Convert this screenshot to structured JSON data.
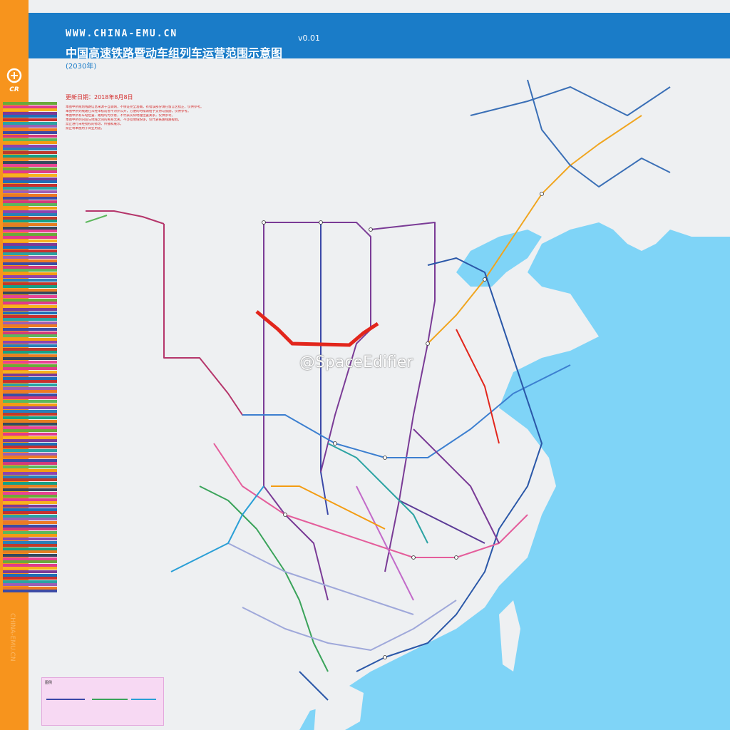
{
  "header": {
    "site_url": "WWW.CHINA-EMU.CN",
    "version": "v0.01",
    "title": "中国高速铁路暨动车组列车运营范围示意图",
    "subtitle": "(2030年)"
  },
  "update_date": "更新日期：2018年8月8日",
  "notes": [
    "本图中所规划线路信息来源于互联网，不保证完全准确，有错误部分请在留言区指正，仅供参考。",
    "本图中所列线路在未经审核前暂不对外公开，方便的时候请给予支持与鼓励，仅供参考。",
    "本图中所有车站位置、路线均为示意，不代表实际地理位置关系，仅供参考。",
    "本图中所列内容与地域之间的关系无关，不涉及地域纷争，仅代表铁路线路规划。",
    "禁止进行未经授权的修改、传播和展示。",
    "禁止将本图用于商业用途。"
  ],
  "watermark": "@SpaceEdifier",
  "side_watermark": "CHINA-EMU.CN",
  "legend_box_title": "图例",
  "colors": {
    "header_bg": "#1a7cc8",
    "side_strip": "#f7941d",
    "sea": "#7fd4f7",
    "land": "#eef0f2",
    "highlight_line": "#e2261c"
  },
  "legend_colors": [
    "#6aaa3a",
    "#e03b8b",
    "#f7b21e",
    "#7e3a96",
    "#1e6fb7",
    "#c8302f",
    "#2ba3a3",
    "#9c5fb5",
    "#ee7a24",
    "#3c4ba5",
    "#d4397a",
    "#5cb85c",
    "#f39c12",
    "#8e44ad",
    "#2980b9",
    "#c0392b",
    "#16a085",
    "#e67e22",
    "#34495e",
    "#e84393"
  ]
}
